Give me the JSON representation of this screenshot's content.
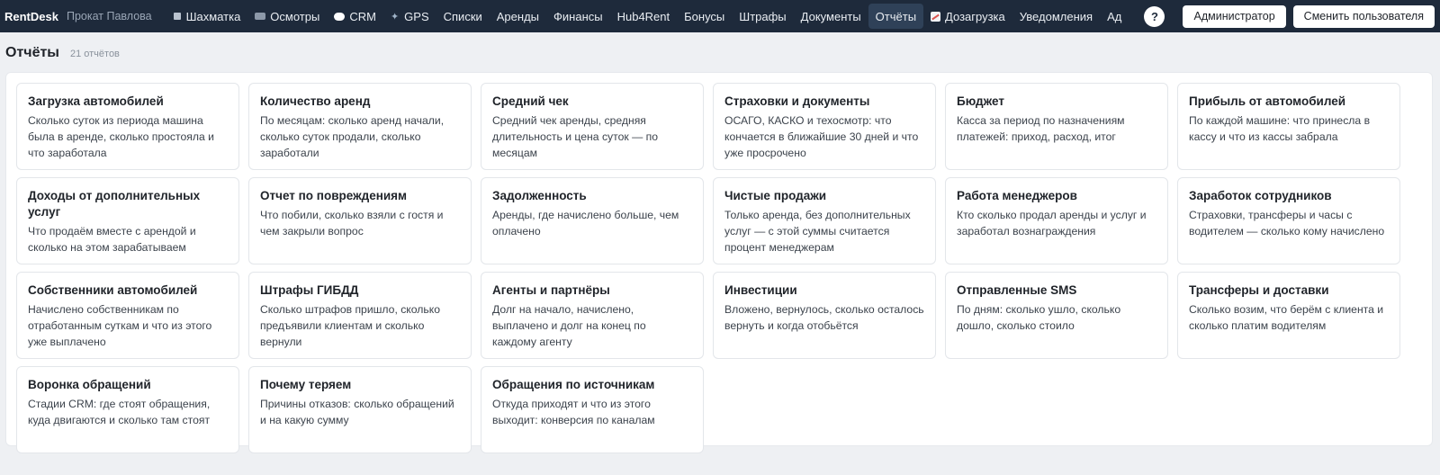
{
  "app": {
    "brand": "RentDesk",
    "company": "Прокат Павлова"
  },
  "nav": {
    "items": [
      {
        "key": "shakhmatka",
        "label": "Шахматка",
        "icon": "grid-square-icon"
      },
      {
        "key": "osmotry",
        "label": "Осмотры",
        "icon": "camera-icon"
      },
      {
        "key": "crm",
        "label": "CRM",
        "icon": "speech-bubble-icon"
      },
      {
        "key": "gps",
        "label": "GPS",
        "icon": "satellite-icon"
      },
      {
        "key": "spiski",
        "label": "Списки"
      },
      {
        "key": "arendy",
        "label": "Аренды"
      },
      {
        "key": "finansy",
        "label": "Финансы"
      },
      {
        "key": "hub4rent",
        "label": "Hub4Rent"
      },
      {
        "key": "bonusy",
        "label": "Бонусы"
      },
      {
        "key": "shtrafy",
        "label": "Штрафы"
      },
      {
        "key": "dokumenty",
        "label": "Документы"
      },
      {
        "key": "otchety",
        "label": "Отчёты",
        "active": true
      },
      {
        "key": "dozagruzka",
        "label": "Дозагрузка",
        "icon": "chart-icon"
      },
      {
        "key": "uvedomleniya",
        "label": "Уведомления"
      },
      {
        "key": "ad",
        "label": "Ад"
      }
    ],
    "help_label": "?",
    "admin_label": "Администратор",
    "switch_user_label": "Сменить пользователя"
  },
  "page": {
    "title": "Отчёты",
    "count": "21 отчётов"
  },
  "reports": [
    {
      "title": "Загрузка автомобилей",
      "desc": "Сколько суток из периода машина была в аренде, сколько простояла и что заработала"
    },
    {
      "title": "Количество аренд",
      "desc": "По месяцам: сколько аренд начали, сколько суток продали, сколько заработали"
    },
    {
      "title": "Средний чек",
      "desc": "Средний чек аренды, средняя длительность и цена суток — по месяцам"
    },
    {
      "title": "Страховки и документы",
      "desc": "ОСАГО, КАСКО и техосмотр: что кончается в ближайшие 30 дней и что уже просрочено"
    },
    {
      "title": "Бюджет",
      "desc": "Касса за период по назначениям платежей: приход, расход, итог"
    },
    {
      "title": "Прибыль от автомобилей",
      "desc": "По каждой машине: что принесла в кассу и что из кассы забрала"
    },
    {
      "title": "Доходы от дополнительных услуг",
      "desc": "Что продаём вместе с арендой и сколько на этом зарабатываем"
    },
    {
      "title": "Отчет по повреждениям",
      "desc": "Что побили, сколько взяли с гостя и чем закрыли вопрос"
    },
    {
      "title": "Задолженность",
      "desc": "Аренды, где начислено больше, чем оплачено"
    },
    {
      "title": "Чистые продажи",
      "desc": "Только аренда, без дополнительных услуг — с этой суммы считается процент менеджерам"
    },
    {
      "title": "Работа менеджеров",
      "desc": "Кто сколько продал аренды и услуг и заработал вознаграждения"
    },
    {
      "title": "Заработок сотрудников",
      "desc": "Страховки, трансферы и часы с водителем — сколько кому начислено"
    },
    {
      "title": "Собственники автомобилей",
      "desc": "Начислено собственникам по отработанным суткам и что из этого уже выплачено"
    },
    {
      "title": "Штрафы ГИБДД",
      "desc": "Сколько штрафов пришло, сколько предъявили клиентам и сколько вернули"
    },
    {
      "title": "Агенты и партнёры",
      "desc": "Долг на начало, начислено, выплачено и долг на конец по каждому агенту"
    },
    {
      "title": "Инвестиции",
      "desc": "Вложено, вернулось, сколько осталось вернуть и когда отобьётся"
    },
    {
      "title": "Отправленные SMS",
      "desc": "По дням: сколько ушло, сколько дошло, сколько стоило"
    },
    {
      "title": "Трансферы и доставки",
      "desc": "Сколько возим, что берём с клиента и сколько платим водителям"
    },
    {
      "title": "Воронка обращений",
      "desc": "Стадии CRM: где стоят обращения, куда двигаются и сколько там стоят"
    },
    {
      "title": "Почему теряем",
      "desc": "Причины отказов: сколько обращений и на какую сумму"
    },
    {
      "title": "Обращения по источникам",
      "desc": "Откуда приходят и что из этого выходит: конверсия по каналам"
    }
  ]
}
